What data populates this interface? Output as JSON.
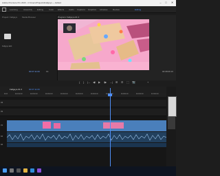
{
  "titlebar": {
    "title": "Adobe Premiere Pro 2023 - C:\\Users\\Projects\\Fallguys — Edited"
  },
  "workspaces": [
    "Learning",
    "Assembly",
    "Editing",
    "Color",
    "Effects",
    "Audio",
    "Captions",
    "Graphics",
    "Libraries",
    "Review",
    "Productions"
  ],
  "active_workspace": "Editing",
  "left_panel": {
    "tabs": [
      "Project: Fallguys",
      "Media Browser"
    ],
    "item_label": "Fallguys Edit"
  },
  "monitor": {
    "tab": "Program: Fallguys-01 ≡",
    "timecode_in": "00:07:11:09",
    "fit": "Fit",
    "timecode_out": "00:08:06:19"
  },
  "transport": [
    "{",
    "}",
    "|←",
    "◀I",
    "▶",
    "I▶",
    "→|",
    "⊞",
    "⊟",
    "⬚",
    "📷",
    "+"
  ],
  "sequence": {
    "tab": "Fallguys-01 ≡",
    "timecode": "00:07:11:09"
  },
  "ruler_ticks": [
    "00:00",
    "00:01:00:00",
    "00:02:00:00",
    "00:03:00:00",
    "00:04:00:00",
    "00:05:00:00",
    "00:06:00:00",
    "00:07:00:00",
    "00:08:00:00",
    "00:09:00:00",
    "00:10:00:00"
  ],
  "tracks": [
    "V3",
    "V2",
    "V1",
    "A1",
    "A2"
  ],
  "colors": {
    "accent": "#4f8ff7",
    "clip_video": "#4a7fbb",
    "clip_audio": "#22405e",
    "game_bg": "#f4a5c8"
  },
  "taskbar_icons": [
    "windows-icon",
    "search-icon",
    "task-view-icon",
    "explorer-icon",
    "edge-icon",
    "premiere-icon"
  ]
}
